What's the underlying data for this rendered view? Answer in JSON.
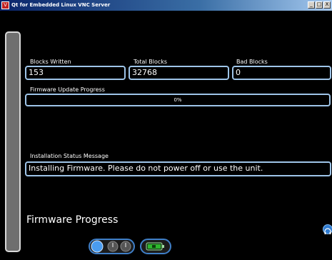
{
  "window": {
    "title": "Qt for Embedded Linux VNC Server",
    "app_icon_glyph": "V",
    "buttons": {
      "minimize": "_",
      "maximize": "□",
      "close": "X"
    }
  },
  "fields": {
    "blocks_written": {
      "label": "Blocks Written",
      "value": "153"
    },
    "total_blocks": {
      "label": "Total Blocks",
      "value": "32768"
    },
    "bad_blocks": {
      "label": "Bad Blocks",
      "value": "0"
    }
  },
  "firmware_update_progress": {
    "label": "Firmware Update Progress",
    "value_percent": 0,
    "text": "0%"
  },
  "installation_status": {
    "label": "Installation Status Message",
    "message": "Installing Firmware.  Please do not power off or use the unit."
  },
  "page_heading": "Firmware Progress",
  "colors": {
    "field_border": "#9ec4e8",
    "accent_blue": "#3f7fc8",
    "battery_green": "#2db82d"
  },
  "icons": {
    "power_toggle": "power-toggle-icon",
    "battery": "battery-icon",
    "right_round": "headset-icon"
  }
}
